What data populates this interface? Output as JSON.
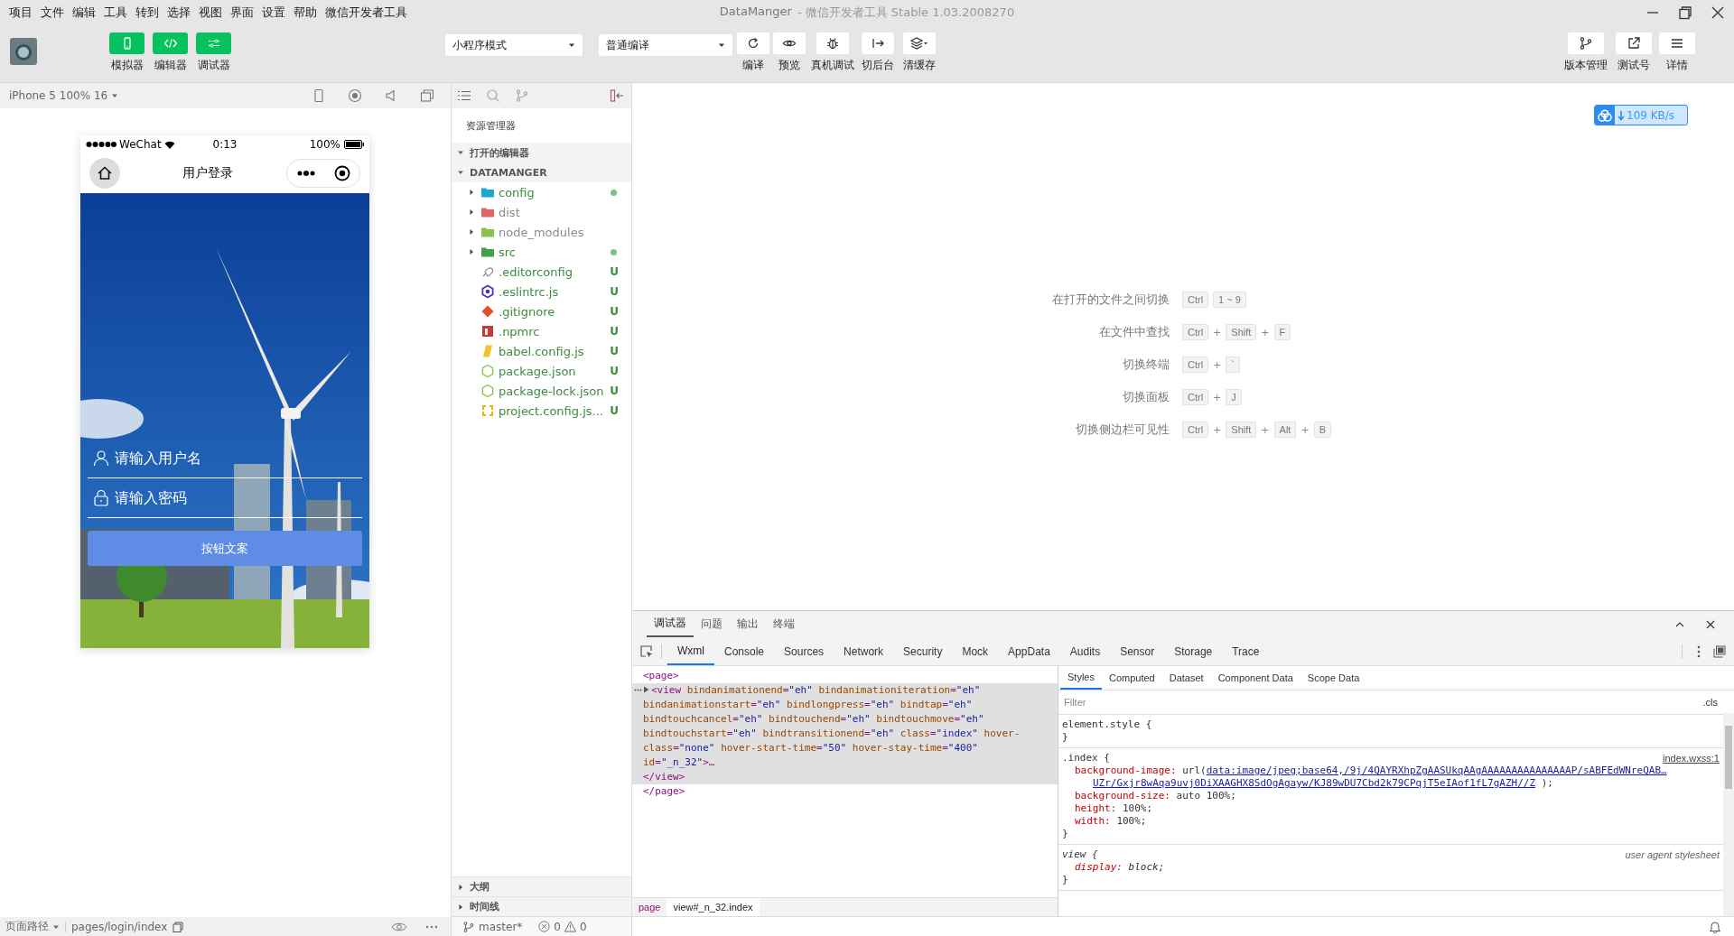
{
  "window": {
    "menu": [
      "项目",
      "文件",
      "编辑",
      "工具",
      "转到",
      "选择",
      "视图",
      "界面",
      "设置",
      "帮助",
      "微信开发者工具"
    ],
    "title": "DataManger",
    "subtitle": "- 微信开发者工具 Stable 1.03.2008270"
  },
  "toolbar": {
    "view_buttons": [
      {
        "label": "模拟器",
        "kind": "phone",
        "on": true
      },
      {
        "label": "编辑器",
        "kind": "code",
        "on": true
      },
      {
        "label": "调试器",
        "kind": "debug",
        "on": true
      }
    ],
    "mode_select": "小程序模式",
    "compile_select": "普通编译",
    "actions": [
      {
        "label": "编译",
        "kind": "refresh"
      },
      {
        "label": "预览",
        "kind": "eye"
      },
      {
        "label": "真机调试",
        "kind": "bug"
      },
      {
        "label": "切后台",
        "kind": "background"
      },
      {
        "label": "清缓存",
        "kind": "layers"
      }
    ],
    "right_actions": [
      {
        "label": "版本管理",
        "kind": "branch"
      },
      {
        "label": "测试号",
        "kind": "share"
      },
      {
        "label": "详情",
        "kind": "menu"
      }
    ]
  },
  "download_badge": {
    "speed": "109 KB/s"
  },
  "simulator": {
    "device": "iPhone 5 100% 16",
    "path_label": "页面路径",
    "path": "pages/login/index",
    "phone": {
      "carrier": "WeChat",
      "time": "0:13",
      "battery": "100%",
      "title": "用户登录",
      "fields": [
        {
          "kind": "user",
          "placeholder": "请输入用户名"
        },
        {
          "kind": "lock",
          "placeholder": "请输入密码"
        }
      ],
      "button": "按钮文案"
    }
  },
  "explorer": {
    "title": "资源管理器",
    "sections": [
      {
        "label": "打开的编辑器",
        "expanded": true
      },
      {
        "label": "DATAMANGER",
        "expanded": true
      }
    ],
    "items": [
      {
        "name": "config",
        "kind": "folder",
        "color": "#1fa5d0",
        "expanded": false,
        "changed": true,
        "ignored": false
      },
      {
        "name": "dist",
        "kind": "folder",
        "color": "#e06666",
        "expanded": false,
        "changed": false,
        "ignored": true
      },
      {
        "name": "node_modules",
        "kind": "folder",
        "color": "#8bc34a",
        "expanded": false,
        "changed": false,
        "ignored": true
      },
      {
        "name": "src",
        "kind": "folder",
        "color": "#43a047",
        "expanded": false,
        "changed": true,
        "ignored": false
      },
      {
        "name": ".editorconfig",
        "kind": "config",
        "color": "#8a8a8a",
        "badge": "U",
        "ignored": false
      },
      {
        "name": ".eslintrc.js",
        "kind": "eslint",
        "color": "#4b32c3",
        "badge": "U",
        "ignored": false
      },
      {
        "name": ".gitignore",
        "kind": "git",
        "color": "#e44d26",
        "badge": "U",
        "ignored": false
      },
      {
        "name": ".npmrc",
        "kind": "npm",
        "color": "#cb3837",
        "badge": "U",
        "ignored": false
      },
      {
        "name": "babel.config.js",
        "kind": "babel",
        "color": "#f2c230",
        "badge": "U",
        "ignored": false
      },
      {
        "name": "package.json",
        "kind": "node",
        "color": "#8bc34a",
        "badge": "U",
        "ignored": false
      },
      {
        "name": "package-lock.json",
        "kind": "node",
        "color": "#8bc34a",
        "badge": "U",
        "ignored": false
      },
      {
        "name": "project.config.js...",
        "kind": "braces",
        "color": "#f0b400",
        "badge": "U",
        "ignored": false
      }
    ],
    "bottom_sections": [
      {
        "label": "大纲",
        "expanded": false
      },
      {
        "label": "时间线",
        "expanded": false
      }
    ],
    "branch": "master*",
    "errors": "0",
    "warnings": "0"
  },
  "editor": {
    "shortcuts": [
      {
        "label": "在打开的文件之间切换",
        "keys": [
          {
            "kind": "key",
            "text": "Ctrl"
          },
          {
            "kind": "key",
            "text": "1 ~ 9"
          }
        ]
      },
      {
        "label": "在文件中查找",
        "keys": [
          {
            "kind": "key",
            "text": "Ctrl"
          },
          {
            "kind": "plus",
            "text": "+"
          },
          {
            "kind": "key",
            "text": "Shift"
          },
          {
            "kind": "plus",
            "text": "+"
          },
          {
            "kind": "key",
            "text": "F"
          }
        ]
      },
      {
        "label": "切换终端",
        "keys": [
          {
            "kind": "key",
            "text": "Ctrl"
          },
          {
            "kind": "plus",
            "text": "+"
          },
          {
            "kind": "key",
            "text": "`"
          }
        ]
      },
      {
        "label": "切换面板",
        "keys": [
          {
            "kind": "key",
            "text": "Ctrl"
          },
          {
            "kind": "plus",
            "text": "+"
          },
          {
            "kind": "key",
            "text": "J"
          }
        ]
      },
      {
        "label": "切换侧边栏可见性",
        "keys": [
          {
            "kind": "key",
            "text": "Ctrl"
          },
          {
            "kind": "plus",
            "text": "+"
          },
          {
            "kind": "key",
            "text": "Shift"
          },
          {
            "kind": "plus",
            "text": "+"
          },
          {
            "kind": "key",
            "text": "Alt"
          },
          {
            "kind": "plus",
            "text": "+"
          },
          {
            "kind": "key",
            "text": "B"
          }
        ]
      }
    ]
  },
  "devtools": {
    "panels": [
      {
        "label": "调试器",
        "selected": true
      },
      {
        "label": "问题",
        "selected": false
      },
      {
        "label": "输出",
        "selected": false
      },
      {
        "label": "终端",
        "selected": false
      }
    ],
    "tabs": [
      {
        "label": "Wxml",
        "selected": true
      },
      {
        "label": "Console",
        "selected": false
      },
      {
        "label": "Sources",
        "selected": false
      },
      {
        "label": "Network",
        "selected": false
      },
      {
        "label": "Security",
        "selected": false
      },
      {
        "label": "Mock",
        "selected": false
      },
      {
        "label": "AppData",
        "selected": false
      },
      {
        "label": "Audits",
        "selected": false
      },
      {
        "label": "Sensor",
        "selected": false
      },
      {
        "label": "Storage",
        "selected": false
      },
      {
        "label": "Trace",
        "selected": false
      }
    ],
    "wxml": [
      {
        "kind": "tag",
        "text": "<page>",
        "selected": false
      },
      {
        "kind": "element",
        "text": "<view bindanimationend=\"eh\" bindanimationiteration=\"eh\" bindanimationstart=\"eh\" bindlongpress=\"eh\" bindtap=\"eh\" bindtouchcancel=\"eh\" bindtouchend=\"eh\" bindtouchmove=\"eh\" bindtouchstart=\"eh\" bindtransitionend=\"eh\" class=\"index\" hover-class=\"none\" hover-start-time=\"50\" hover-stay-time=\"400\" id=\"_n_32\">…",
        "selected": true
      },
      {
        "kind": "tag",
        "text": "</view>",
        "selected": true
      },
      {
        "kind": "tag",
        "text": "</page>",
        "selected": false
      }
    ],
    "breadcrumbs": [
      {
        "label": "page",
        "selected": false
      },
      {
        "label": "view#_n_32.index",
        "selected": true
      }
    ],
    "style_tabs": [
      {
        "label": "Styles",
        "selected": true
      },
      {
        "label": "Computed",
        "selected": false
      },
      {
        "label": "Dataset",
        "selected": false
      },
      {
        "label": "Component Data",
        "selected": false
      },
      {
        "label": "Scope Data",
        "selected": false
      }
    ],
    "filter_placeholder": "Filter",
    "cls": ".cls",
    "rules": [
      {
        "open": "element.style {",
        "kind": "inline",
        "close": "}"
      },
      {
        "open": ".index {",
        "kind": "author",
        "source": "index.wxss:1",
        "close": "}",
        "declarations": [
          {
            "name": "background-image:",
            "parts": [
              {
                "kind": "text",
                "text": "url("
              },
              {
                "kind": "link",
                "text": "data:image/jpeg;base64,/9j/4QAYRXhpZgAASUkqAAgAAAAAAAAAAAAAAAP/sABFEdWNreQAB…"
              },
              {
                "kind": "link",
                "text": "UZr/Gxjr8wAqa9uvj0DiXAAGHX8SdOgAgayw/KJ89wDU7Cbd2k79CPqjT5eIAof1fL7gAZH//Z"
              },
              {
                "kind": "text",
                "text": ");"
              }
            ]
          },
          {
            "name": "background-size:",
            "parts": [
              {
                "kind": "text",
                "text": "auto 100%;"
              }
            ]
          },
          {
            "name": "height:",
            "parts": [
              {
                "kind": "text",
                "text": "100%;"
              }
            ]
          },
          {
            "name": "width:",
            "parts": [
              {
                "kind": "text",
                "text": "100%;"
              }
            ]
          }
        ]
      },
      {
        "open": "view {",
        "kind": "user-agent",
        "source": "user agent stylesheet",
        "close": "}",
        "declarations": [
          {
            "name": "display:",
            "parts": [
              {
                "kind": "text",
                "text": "block;"
              }
            ]
          }
        ]
      }
    ]
  }
}
